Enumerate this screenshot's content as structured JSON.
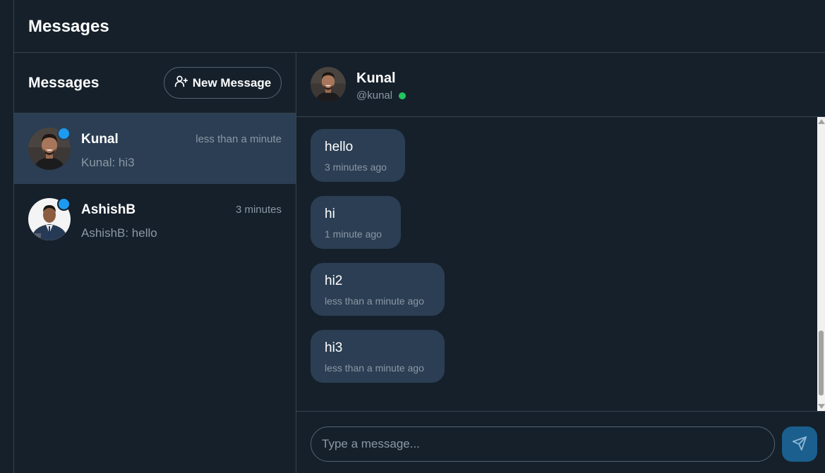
{
  "header": {
    "title": "Messages"
  },
  "conversations": {
    "title": "Messages",
    "new_message_label": "New Message",
    "items": [
      {
        "name": "Kunal",
        "time": "less than a minute",
        "preview": "Kunal: hi3",
        "unread": true,
        "active": true
      },
      {
        "name": "AshishB",
        "time": "3 minutes",
        "preview": "AshishB: hello",
        "unread": true,
        "active": false
      }
    ]
  },
  "chat": {
    "name": "Kunal",
    "handle": "@kunal",
    "online": true,
    "messages": [
      {
        "text": "hello",
        "time": "3 minutes ago"
      },
      {
        "text": "hi",
        "time": "1 minute ago"
      },
      {
        "text": "hi2",
        "time": "less than a minute ago"
      },
      {
        "text": "hi3",
        "time": "less than a minute ago"
      }
    ],
    "input_placeholder": "Type a message..."
  },
  "colors": {
    "background": "#15202b",
    "active_item": "#2b3e53",
    "bubble": "#2b3e53",
    "unread": "#1d9bf0",
    "online": "#22c55e",
    "send_button": "#1a5f8e",
    "border": "#38444d"
  },
  "icons": {
    "new_message": "user-plus-icon",
    "send": "send-icon"
  }
}
